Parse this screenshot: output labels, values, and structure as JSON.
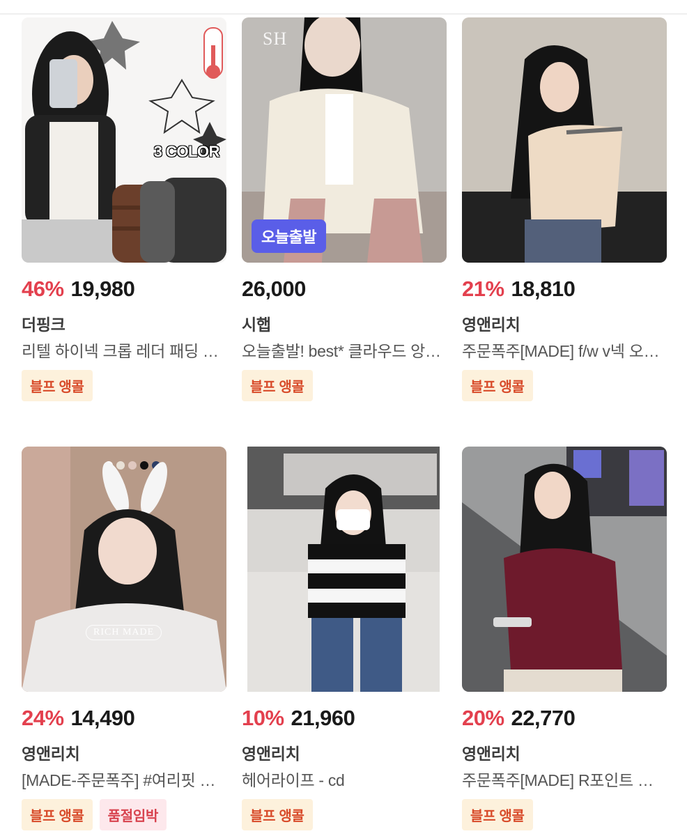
{
  "products": [
    {
      "discount": "46%",
      "price": "19,980",
      "shop": "더핑크",
      "title": "리텔 하이넥 크롭 레더 패딩 베스트",
      "overlay": "3 COLOR",
      "tags": [
        "블프 앵콜"
      ]
    },
    {
      "discount": "",
      "price": "26,000",
      "shop": "시햅",
      "title": "오늘출발! best* 클라우드 앙고라 가디건",
      "overlay": "오늘출발",
      "logo": "SH",
      "tags": [
        "블프 앵콜"
      ]
    },
    {
      "discount": "21%",
      "price": "18,810",
      "shop": "영앤리치",
      "title": "주문폭주[MADE] f/w v넥 오프숄더 티셔츠",
      "tags": [
        "블프 앵콜"
      ]
    },
    {
      "discount": "24%",
      "price": "14,490",
      "shop": "영앤리치",
      "title": "[MADE-주문폭주] #여리핏 골지 티셔츠",
      "watermark": "RICH MADE",
      "tags": [
        "블프 앵콜",
        "품절임박"
      ]
    },
    {
      "discount": "10%",
      "price": "21,960",
      "shop": "영앤리치",
      "title": "헤어라이프 - cd",
      "tags": [
        "블프 앵콜"
      ]
    },
    {
      "discount": "20%",
      "price": "22,770",
      "shop": "영앤리치",
      "title": "주문폭주[MADE] R포인트 컷아웃 티셔츠",
      "tags": [
        "블프 앵콜"
      ]
    }
  ]
}
